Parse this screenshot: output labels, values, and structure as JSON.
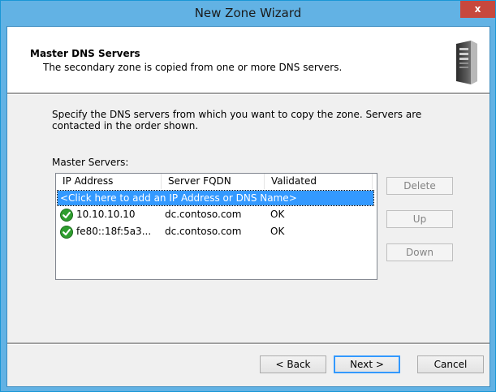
{
  "window": {
    "title": "New Zone Wizard",
    "close_glyph": "x"
  },
  "header": {
    "title": "Master DNS Servers",
    "subtitle": "The secondary zone is copied from one or more DNS servers.",
    "icon": "server-tower-icon"
  },
  "body": {
    "description": "Specify the DNS servers from which you want to copy the zone.  Servers are contacted in the order shown.",
    "master_label": "Master Servers:"
  },
  "list": {
    "columns": [
      "IP Address",
      "Server FQDN",
      "Validated"
    ],
    "add_row": "<Click here to add an IP Address or DNS Name>",
    "rows": [
      {
        "ip": "10.10.10.10",
        "fqdn": "dc.contoso.com",
        "validated": "OK",
        "icon": "green-check-icon"
      },
      {
        "ip": "fe80::18f:5a3...",
        "fqdn": "dc.contoso.com",
        "validated": "OK",
        "icon": "green-check-icon"
      }
    ]
  },
  "side_buttons": {
    "delete": "Delete",
    "up": "Up",
    "down": "Down"
  },
  "footer": {
    "back": "< Back",
    "next": "Next >",
    "cancel": "Cancel"
  },
  "colors": {
    "titlebar": "#62b2e4",
    "close": "#c7483d",
    "selection": "#3399ff",
    "check": "#2f9e2f"
  }
}
